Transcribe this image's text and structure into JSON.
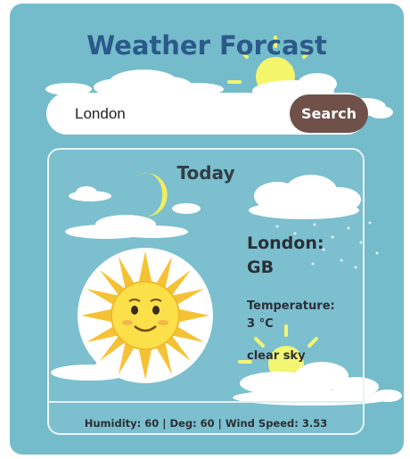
{
  "app": {
    "title": "Weather Forcast"
  },
  "search": {
    "value": "London",
    "placeholder": "",
    "button_label": "Search"
  },
  "card": {
    "heading": "Today",
    "city": "London: GB",
    "temperature_label": "Temperature:",
    "temperature_value": "3 °C",
    "condition": "clear sky",
    "condition_icon": "smiling-sun-icon",
    "details": "Humidity: 60 | Deg: 60 | Wind Speed: 3.53"
  },
  "colors": {
    "background": "#74bccb",
    "title": "#2b5a8a",
    "search_button": "#6f5149",
    "text": "#2a2f36"
  }
}
